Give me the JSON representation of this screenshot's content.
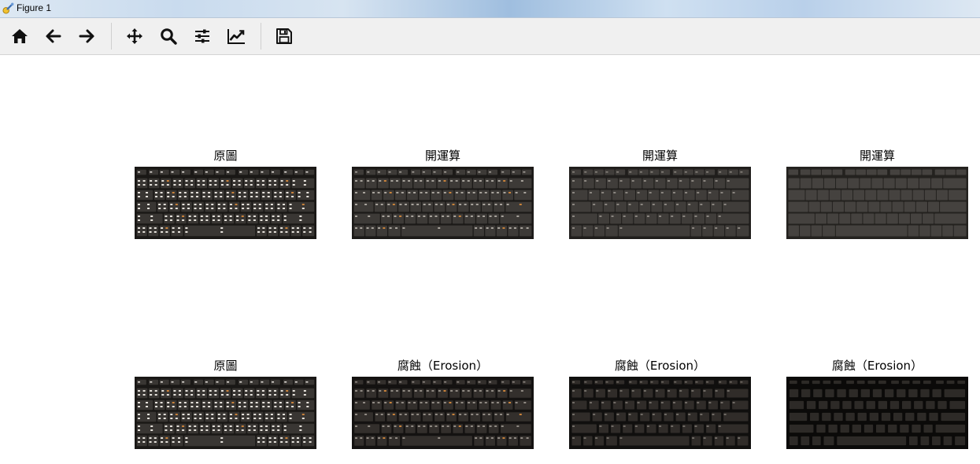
{
  "window": {
    "title": "Figure 1"
  },
  "toolbar": {
    "buttons": [
      {
        "name": "home-button",
        "icon": "home-icon"
      },
      {
        "name": "back-button",
        "icon": "arrow-left-icon"
      },
      {
        "name": "forward-button",
        "icon": "arrow-right-icon"
      },
      {
        "name": "pan-button",
        "icon": "move-icon"
      },
      {
        "name": "zoom-button",
        "icon": "magnifier-icon"
      },
      {
        "name": "configure-subplots-button",
        "icon": "sliders-icon"
      },
      {
        "name": "edit-axes-button",
        "icon": "line-chart-icon"
      },
      {
        "name": "save-button",
        "icon": "floppy-disk-icon"
      }
    ]
  },
  "figure": {
    "subplots": [
      {
        "title": "原圖",
        "variant": "original"
      },
      {
        "title": "開運算",
        "variant": "open1"
      },
      {
        "title": "開運算",
        "variant": "open2"
      },
      {
        "title": "開運算",
        "variant": "open3"
      },
      {
        "title": "原圖",
        "variant": "original"
      },
      {
        "title": "腐蝕（Erosion）",
        "variant": "erode1"
      },
      {
        "title": "腐蝕（Erosion）",
        "variant": "erode2"
      },
      {
        "title": "腐蝕（Erosion）",
        "variant": "erode3"
      }
    ]
  }
}
